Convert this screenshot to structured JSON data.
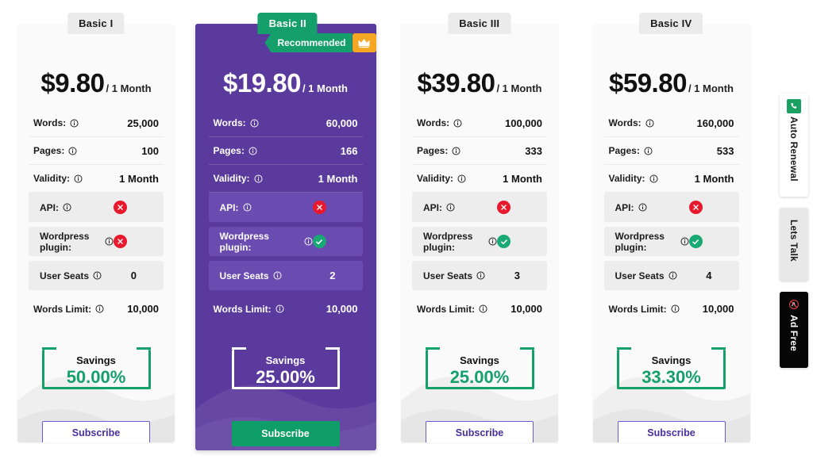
{
  "plans": [
    {
      "tab_label": "Basic I",
      "featured": false,
      "price": "$9.80",
      "period": "/ 1 Month",
      "rows": [
        {
          "label": "Words:",
          "value": "25,000",
          "type": "text",
          "shaded": false
        },
        {
          "label": "Pages:",
          "value": "100",
          "type": "text",
          "shaded": false
        },
        {
          "label": "Validity:",
          "value": "1 Month",
          "type": "text",
          "shaded": false
        },
        {
          "label": "API:",
          "value": "no",
          "type": "icon",
          "shaded": true
        },
        {
          "label": "Wordpress plugin:",
          "value": "no",
          "type": "icon",
          "shaded": true
        },
        {
          "label": "User Seats",
          "value": "0",
          "type": "text",
          "shaded": true
        },
        {
          "label": "Words Limit:",
          "value": "10,000",
          "type": "text",
          "shaded": false
        }
      ],
      "savings_label": "Savings",
      "savings_value": "50.00%",
      "subscribe_label": "Subscribe"
    },
    {
      "tab_label": "Basic II",
      "featured": true,
      "ribbon_label": "Recommended",
      "ribbon_icon": "crown-icon",
      "price": "$19.80",
      "period": "/ 1 Month",
      "rows": [
        {
          "label": "Words:",
          "value": "60,000",
          "type": "text",
          "shaded": false
        },
        {
          "label": "Pages:",
          "value": "166",
          "type": "text",
          "shaded": false
        },
        {
          "label": "Validity:",
          "value": "1 Month",
          "type": "text",
          "shaded": false
        },
        {
          "label": "API:",
          "value": "no",
          "type": "icon",
          "shaded": true
        },
        {
          "label": "Wordpress plugin:",
          "value": "yes",
          "type": "icon",
          "shaded": true
        },
        {
          "label": "User Seats",
          "value": "2",
          "type": "text",
          "shaded": true
        },
        {
          "label": "Words Limit:",
          "value": "10,000",
          "type": "text",
          "shaded": false
        }
      ],
      "savings_label": "Savings",
      "savings_value": "25.00%",
      "subscribe_label": "Subscribe"
    },
    {
      "tab_label": "Basic III",
      "featured": false,
      "price": "$39.80",
      "period": "/ 1 Month",
      "rows": [
        {
          "label": "Words:",
          "value": "100,000",
          "type": "text",
          "shaded": false
        },
        {
          "label": "Pages:",
          "value": "333",
          "type": "text",
          "shaded": false
        },
        {
          "label": "Validity:",
          "value": "1 Month",
          "type": "text",
          "shaded": false
        },
        {
          "label": "API:",
          "value": "no",
          "type": "icon",
          "shaded": true
        },
        {
          "label": "Wordpress plugin:",
          "value": "yes",
          "type": "icon",
          "shaded": true
        },
        {
          "label": "User Seats",
          "value": "3",
          "type": "text",
          "shaded": true
        },
        {
          "label": "Words Limit:",
          "value": "10,000",
          "type": "text",
          "shaded": false
        }
      ],
      "savings_label": "Savings",
      "savings_value": "25.00%",
      "subscribe_label": "Subscribe"
    },
    {
      "tab_label": "Basic IV",
      "featured": false,
      "price": "$59.80",
      "period": "/ 1 Month",
      "rows": [
        {
          "label": "Words:",
          "value": "160,000",
          "type": "text",
          "shaded": false
        },
        {
          "label": "Pages:",
          "value": "533",
          "type": "text",
          "shaded": false
        },
        {
          "label": "Validity:",
          "value": "1 Month",
          "type": "text",
          "shaded": false
        },
        {
          "label": "API:",
          "value": "no",
          "type": "icon",
          "shaded": true
        },
        {
          "label": "Wordpress plugin:",
          "value": "yes",
          "type": "icon",
          "shaded": true
        },
        {
          "label": "User Seats",
          "value": "4",
          "type": "text",
          "shaded": true
        },
        {
          "label": "Words Limit:",
          "value": "10,000",
          "type": "text",
          "shaded": false
        }
      ],
      "savings_label": "Savings",
      "savings_value": "33.30%",
      "subscribe_label": "Subscribe"
    }
  ],
  "side_tabs": [
    {
      "label": "Auto Renewal",
      "icon": "phone-call-icon",
      "theme": "light"
    },
    {
      "label": "Lets Talk",
      "icon": null,
      "theme": "grey"
    },
    {
      "label": "Ad Free",
      "icon": "no-ads-icon",
      "theme": "dark"
    }
  ],
  "colors": {
    "featured_bg": "#5b3a9e",
    "green": "#15a06b",
    "red": "#e8192c",
    "amber": "#f5a623",
    "card_bg": "#fafafa",
    "link_purple": "#4b2e9e"
  }
}
